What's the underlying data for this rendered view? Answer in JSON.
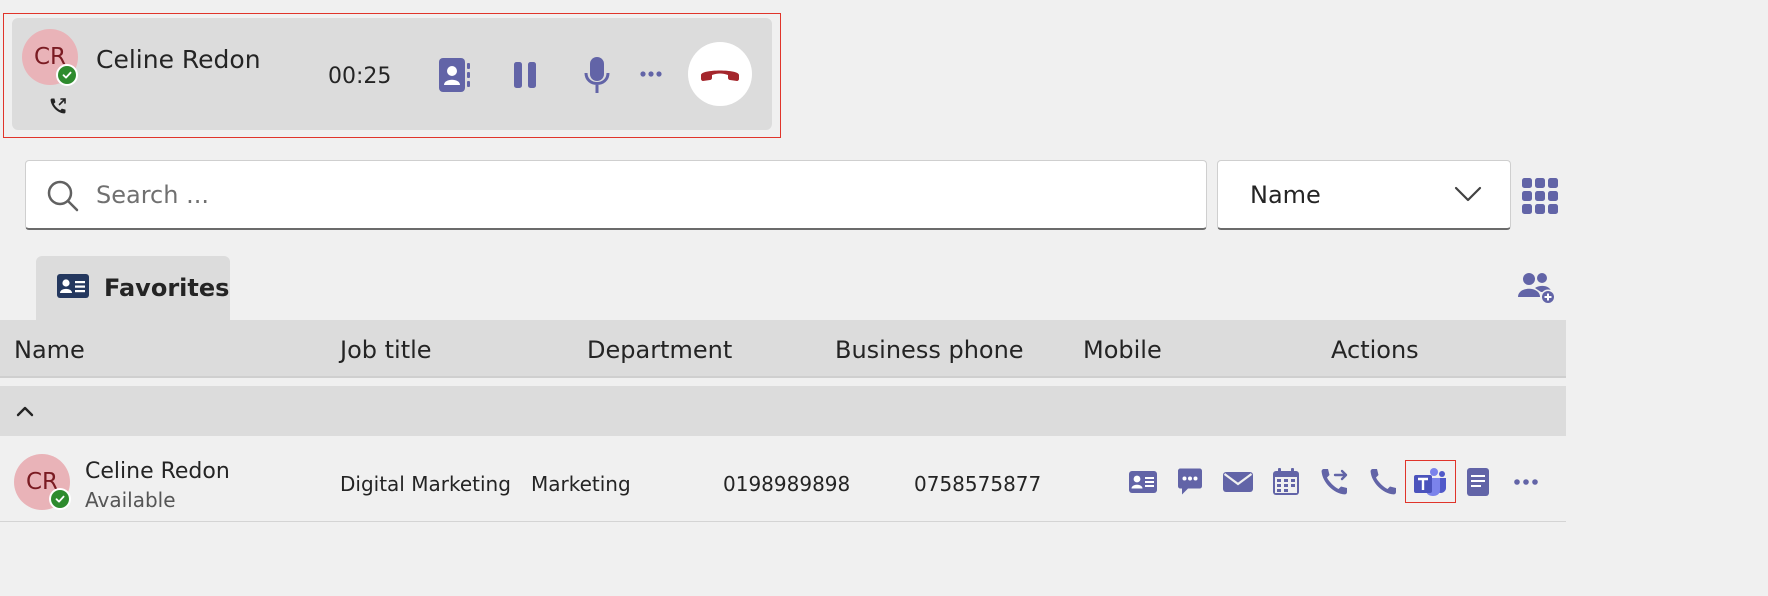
{
  "call": {
    "initials": "CR",
    "caller_name": "Celine Redon",
    "timer": "00:25"
  },
  "search": {
    "placeholder": "Search ...",
    "value": ""
  },
  "sort": {
    "selected": "Name"
  },
  "tabs": [
    {
      "label": "Favorites",
      "icon": "contact-card-icon",
      "active": true
    }
  ],
  "table": {
    "columns": [
      "Name",
      "Job title",
      "Department",
      "Business phone",
      "Mobile",
      "Actions"
    ],
    "rows": [
      {
        "initials": "CR",
        "name": "Celine Redon",
        "status": "Available",
        "job_title": "Digital Marketing",
        "department": "Marketing",
        "business_phone": "0198989898",
        "mobile": "0758575877",
        "actions": [
          "contact-card-icon",
          "chat-icon",
          "mail-icon",
          "calendar-icon",
          "transfer-call-icon",
          "call-icon",
          "teams-icon",
          "notes-icon",
          "more-icon"
        ]
      }
    ]
  },
  "colors": {
    "accent": "#6264a7",
    "end_call": "#a4262c",
    "presence_available": "#2e8b2e",
    "avatar_bg": "#e9b3b8",
    "avatar_fg": "#7a1b22",
    "highlight": "#e0342a"
  }
}
